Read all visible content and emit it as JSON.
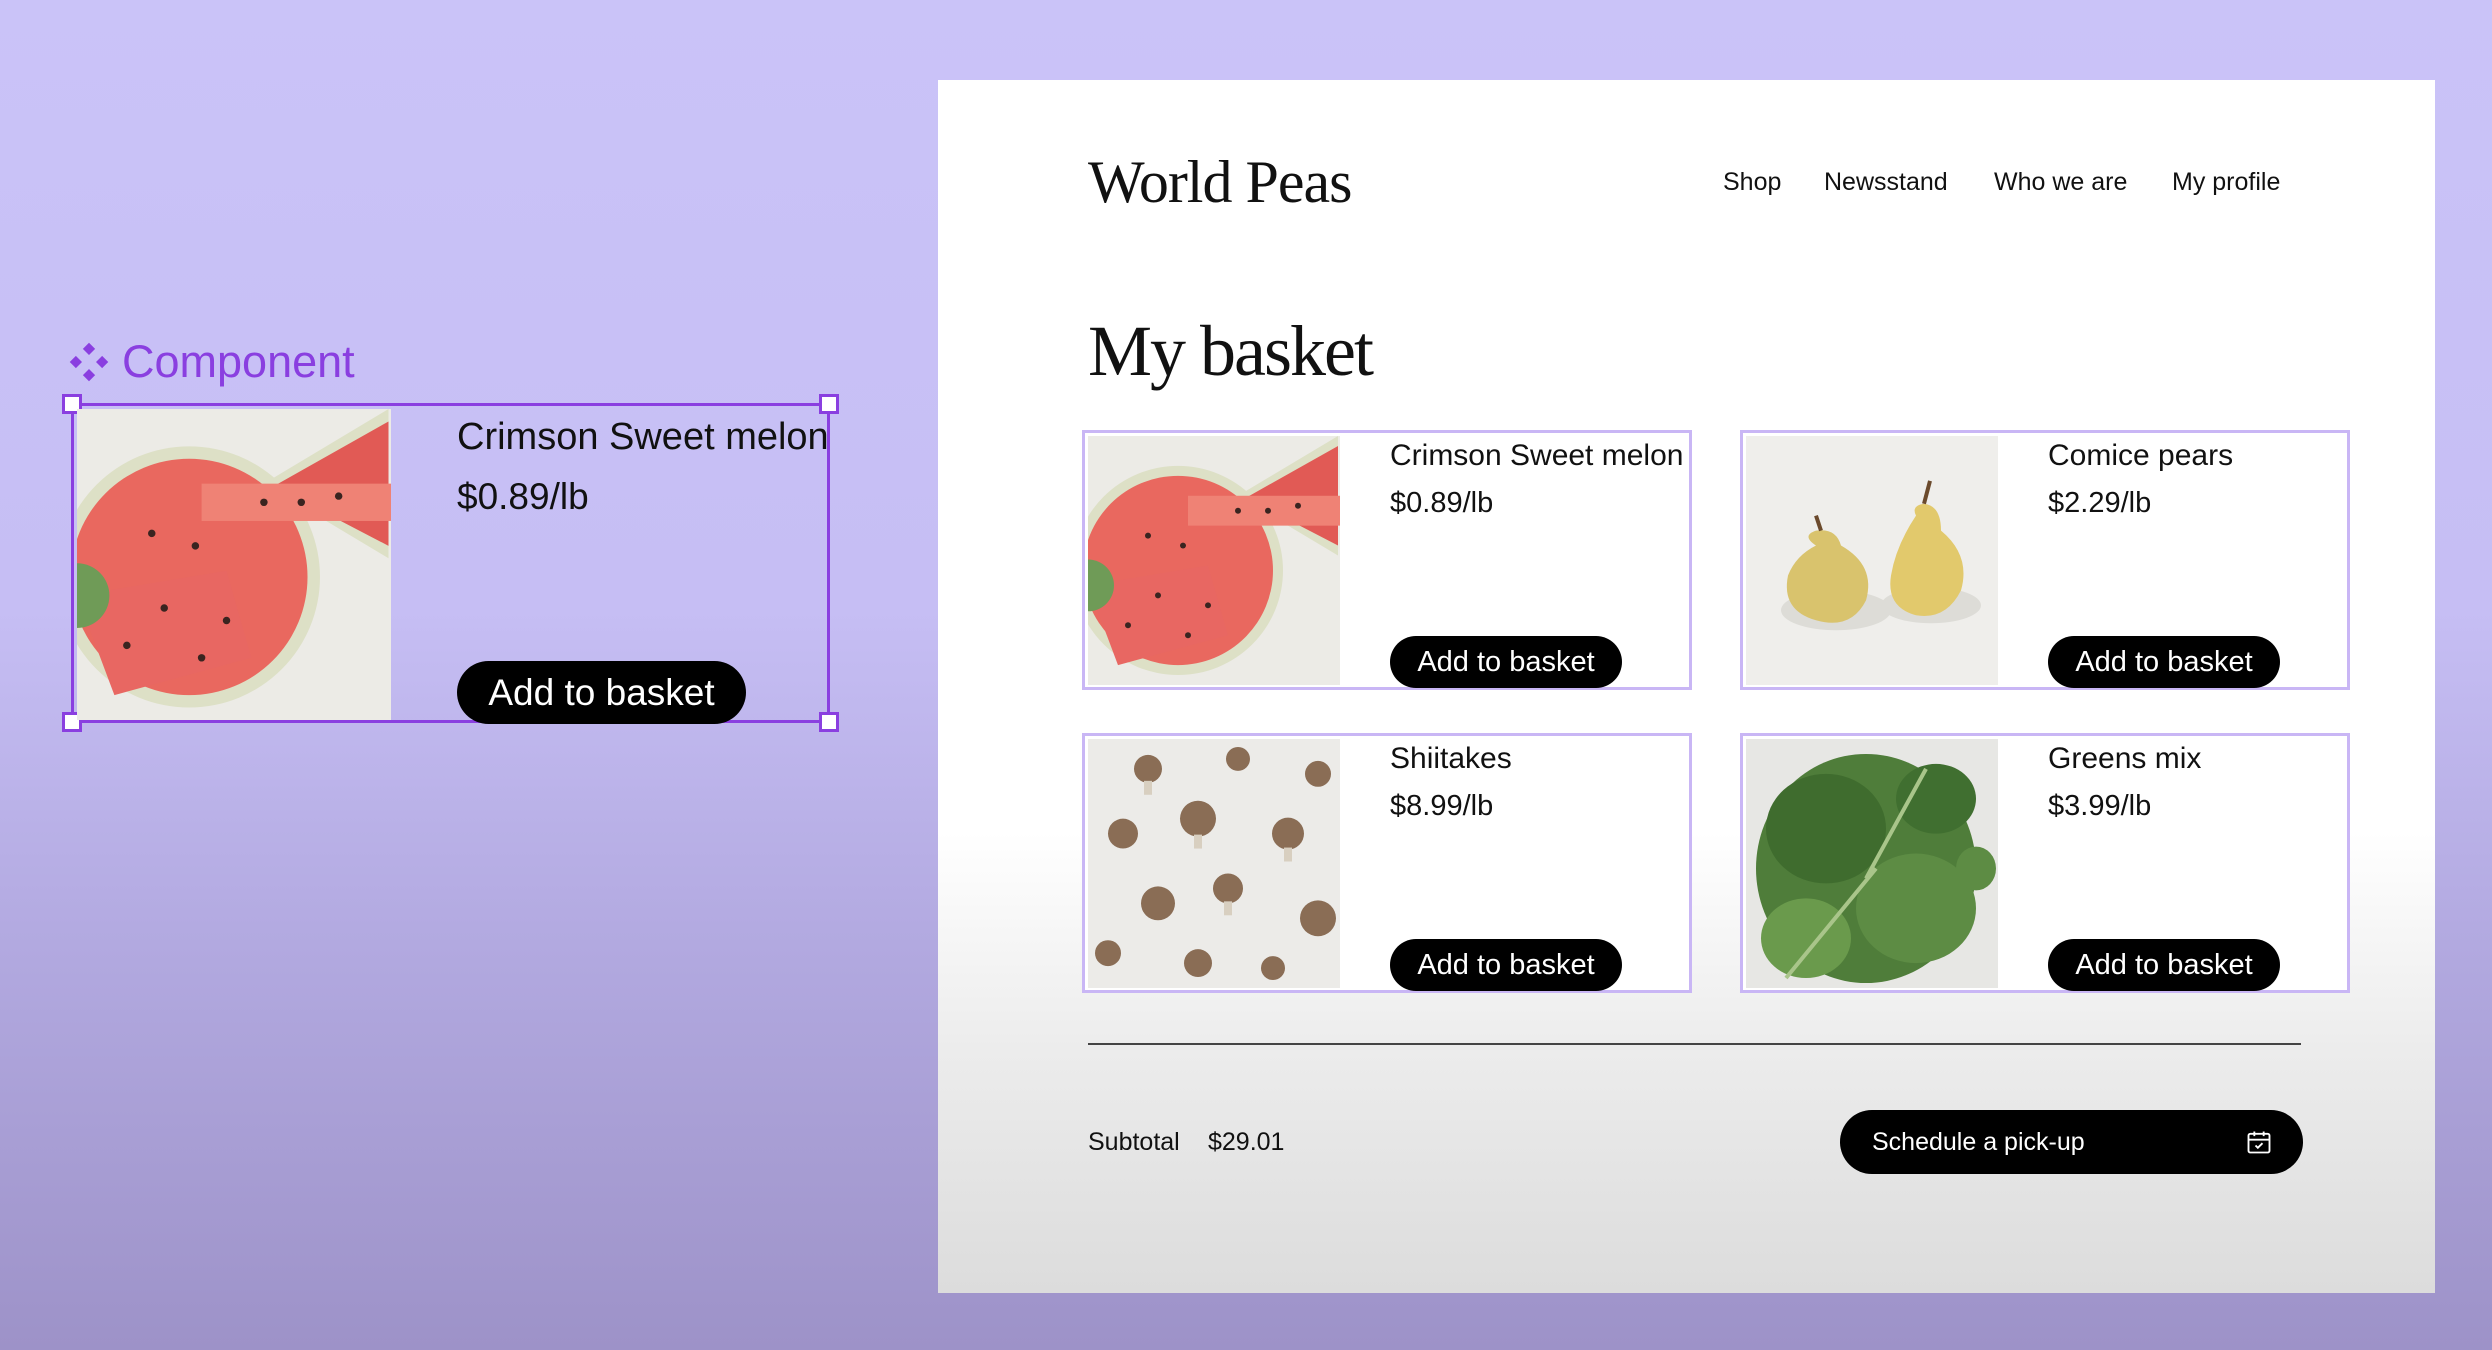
{
  "component_annotation": {
    "label": "Component",
    "icon": "component-icon",
    "accent_color": "#8a3fe0",
    "card": {
      "name": "Crimson Sweet melon",
      "price": "$0.89/lb",
      "button": "Add to basket",
      "image_icon": "watermelon-image"
    }
  },
  "site": {
    "brand": "World Peas",
    "nav": [
      "Shop",
      "Newsstand",
      "Who we are",
      "My profile"
    ]
  },
  "basket": {
    "title": "My basket",
    "items": [
      {
        "name": "Crimson Sweet melon",
        "price": "$0.89/lb",
        "button": "Add to basket",
        "image": "watermelon-image"
      },
      {
        "name": "Comice pears",
        "price": "$2.29/lb",
        "button": "Add to basket",
        "image": "pears-image"
      },
      {
        "name": "Shiitakes",
        "price": "$8.99/lb",
        "button": "Add to basket",
        "image": "mushrooms-image"
      },
      {
        "name": "Greens mix",
        "price": "$3.99/lb",
        "button": "Add to basket",
        "image": "greens-image"
      }
    ],
    "subtotal_label": "Subtotal",
    "subtotal_value": "$29.01",
    "pickup_button": "Schedule a pick-up",
    "pickup_icon": "calendar-icon"
  },
  "colors": {
    "background": "#c6bef4",
    "card_border": "#c9b6f5",
    "button": "#000000"
  }
}
